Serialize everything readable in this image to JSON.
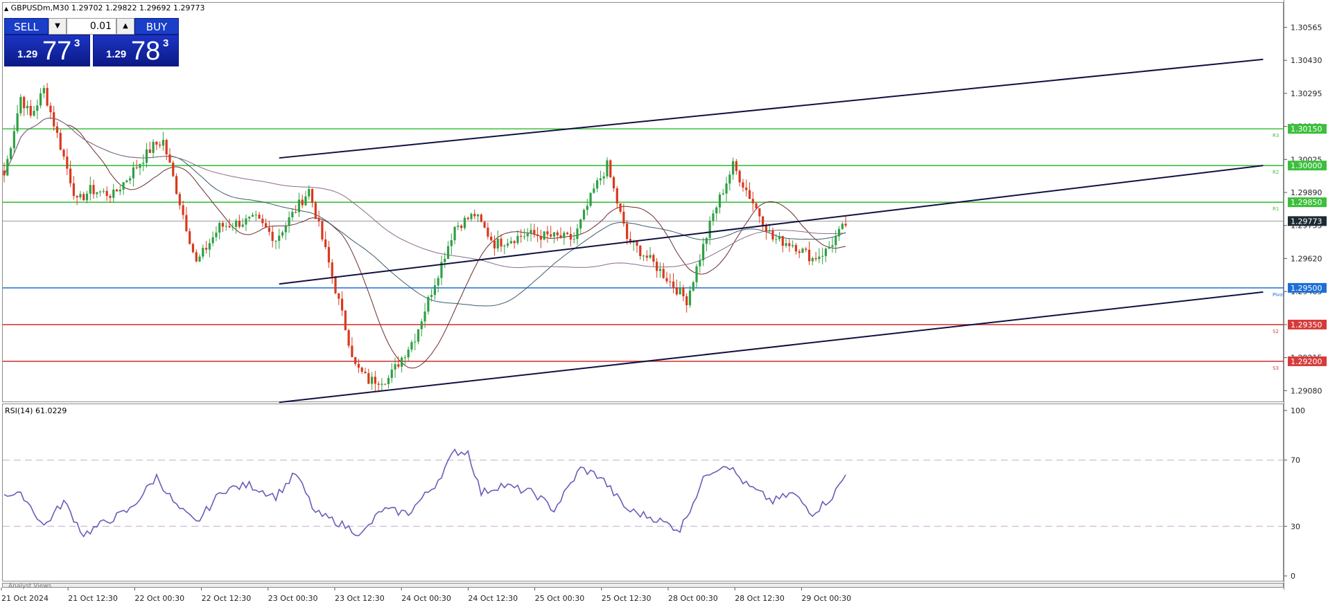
{
  "header": {
    "arrow_icon": "triangle-up-icon",
    "symbol_info": "GBPUSDm,M30  1.29702 1.29822 1.29692 1.29773"
  },
  "trade_panel": {
    "sell_label": "SELL",
    "buy_label": "BUY",
    "volume": "0.01",
    "sell_price": {
      "prefix": "1.29",
      "big": "77",
      "sup": "3"
    },
    "buy_price": {
      "prefix": "1.29",
      "big": "78",
      "sup": "3"
    }
  },
  "price_axis": {
    "ticks": [
      "1.30565",
      "1.30430",
      "1.30295",
      "1.30160",
      "1.30025",
      "1.29890",
      "1.29755",
      "1.29620",
      "1.29485",
      "1.29350",
      "1.29215",
      "1.29080"
    ]
  },
  "levels": [
    {
      "label": "1.30150",
      "value": 1.3015,
      "color": "#3cbf3c",
      "tag": "R3"
    },
    {
      "label": "1.30000",
      "value": 1.3,
      "color": "#3cbf3c",
      "tag": "R2"
    },
    {
      "label": "1.29850",
      "value": 1.2985,
      "color": "#3cbf3c",
      "tag": "R1"
    },
    {
      "label": "1.29500",
      "value": 1.295,
      "color": "#1d6fd6",
      "tag": "Pivot"
    },
    {
      "label": "1.29350",
      "value": 1.2935,
      "color": "#d63a3a",
      "tag": "S2"
    },
    {
      "label": "1.29200",
      "value": 1.292,
      "color": "#d63a3a",
      "tag": "S3"
    }
  ],
  "current_price": {
    "label": "1.29773",
    "value": 1.29773,
    "color": "#1c2a33"
  },
  "rsi": {
    "title": "RSI(14) 61.0229",
    "ticks": [
      "100",
      "70",
      "30",
      "0"
    ],
    "levels": [
      70,
      30
    ],
    "color": "#6a5cb8"
  },
  "bottom_panel_label": "Analyst Views",
  "time_axis": {
    "labels": [
      "21 Oct 2024",
      "21 Oct 12:30",
      "22 Oct 00:30",
      "22 Oct 12:30",
      "23 Oct 00:30",
      "23 Oct 12:30",
      "24 Oct 00:30",
      "24 Oct 12:30",
      "25 Oct 00:30",
      "25 Oct 12:30",
      "28 Oct 00:30",
      "28 Oct 12:30",
      "29 Oct 00:30"
    ]
  },
  "chart_data": {
    "type": "candlestick",
    "symbol": "GBPUSDm",
    "timeframe": "M30",
    "ylim": [
      1.2903,
      1.3062
    ],
    "bull_color": "#2ea043",
    "bear_color": "#d9381e",
    "key_points": [
      {
        "t": 0,
        "p": 1.2996
      },
      {
        "t": 5,
        "p": 1.3028
      },
      {
        "t": 8,
        "p": 1.302
      },
      {
        "t": 12,
        "p": 1.3031
      },
      {
        "t": 22,
        "p": 1.2985
      },
      {
        "t": 26,
        "p": 1.299
      },
      {
        "t": 33,
        "p": 1.2988
      },
      {
        "t": 45,
        "p": 1.3008
      },
      {
        "t": 48,
        "p": 1.301
      },
      {
        "t": 58,
        "p": 1.296
      },
      {
        "t": 65,
        "p": 1.2975
      },
      {
        "t": 76,
        "p": 1.2978
      },
      {
        "t": 82,
        "p": 1.297
      },
      {
        "t": 92,
        "p": 1.299
      },
      {
        "t": 98,
        "p": 1.296
      },
      {
        "t": 106,
        "p": 1.2918
      },
      {
        "t": 110,
        "p": 1.2912
      },
      {
        "t": 116,
        "p": 1.2913
      },
      {
        "t": 124,
        "p": 1.293
      },
      {
        "t": 128,
        "p": 1.2945
      },
      {
        "t": 136,
        "p": 1.2975
      },
      {
        "t": 142,
        "p": 1.298
      },
      {
        "t": 148,
        "p": 1.2968
      },
      {
        "t": 158,
        "p": 1.2972
      },
      {
        "t": 172,
        "p": 1.297
      },
      {
        "t": 178,
        "p": 1.299
      },
      {
        "t": 182,
        "p": 1.3
      },
      {
        "t": 188,
        "p": 1.297
      },
      {
        "t": 196,
        "p": 1.296
      },
      {
        "t": 206,
        "p": 1.2945
      },
      {
        "t": 214,
        "p": 1.298
      },
      {
        "t": 220,
        "p": 1.3
      },
      {
        "t": 224,
        "p": 1.299
      },
      {
        "t": 232,
        "p": 1.297
      },
      {
        "t": 238,
        "p": 1.2968
      },
      {
        "t": 244,
        "p": 1.2962
      },
      {
        "t": 248,
        "p": 1.2965
      },
      {
        "t": 254,
        "p": 1.2976
      }
    ],
    "rsi_points": [
      {
        "t": 0,
        "v": 50
      },
      {
        "t": 6,
        "v": 48
      },
      {
        "t": 12,
        "v": 30
      },
      {
        "t": 18,
        "v": 45
      },
      {
        "t": 24,
        "v": 25
      },
      {
        "t": 30,
        "v": 32
      },
      {
        "t": 38,
        "v": 40
      },
      {
        "t": 46,
        "v": 60
      },
      {
        "t": 52,
        "v": 42
      },
      {
        "t": 58,
        "v": 32
      },
      {
        "t": 66,
        "v": 52
      },
      {
        "t": 74,
        "v": 55
      },
      {
        "t": 82,
        "v": 48
      },
      {
        "t": 88,
        "v": 62
      },
      {
        "t": 94,
        "v": 38
      },
      {
        "t": 100,
        "v": 33
      },
      {
        "t": 108,
        "v": 25
      },
      {
        "t": 114,
        "v": 40
      },
      {
        "t": 122,
        "v": 38
      },
      {
        "t": 130,
        "v": 55
      },
      {
        "t": 136,
        "v": 75
      },
      {
        "t": 140,
        "v": 75
      },
      {
        "t": 144,
        "v": 50
      },
      {
        "t": 150,
        "v": 55
      },
      {
        "t": 160,
        "v": 50
      },
      {
        "t": 166,
        "v": 40
      },
      {
        "t": 174,
        "v": 65
      },
      {
        "t": 180,
        "v": 60
      },
      {
        "t": 188,
        "v": 40
      },
      {
        "t": 196,
        "v": 35
      },
      {
        "t": 204,
        "v": 28
      },
      {
        "t": 212,
        "v": 62
      },
      {
        "t": 218,
        "v": 68
      },
      {
        "t": 224,
        "v": 55
      },
      {
        "t": 232,
        "v": 45
      },
      {
        "t": 238,
        "v": 50
      },
      {
        "t": 244,
        "v": 38
      },
      {
        "t": 250,
        "v": 48
      },
      {
        "t": 254,
        "v": 61
      }
    ],
    "trend_lines": [
      {
        "t1": 83,
        "p1": 1.30031,
        "t2": 380,
        "p2": 1.30434
      },
      {
        "t1": 83,
        "p1": 1.29516,
        "t2": 380,
        "p2": 1.3
      },
      {
        "t1": 83,
        "p1": 1.29032,
        "t2": 380,
        "p2": 1.29483
      }
    ]
  }
}
